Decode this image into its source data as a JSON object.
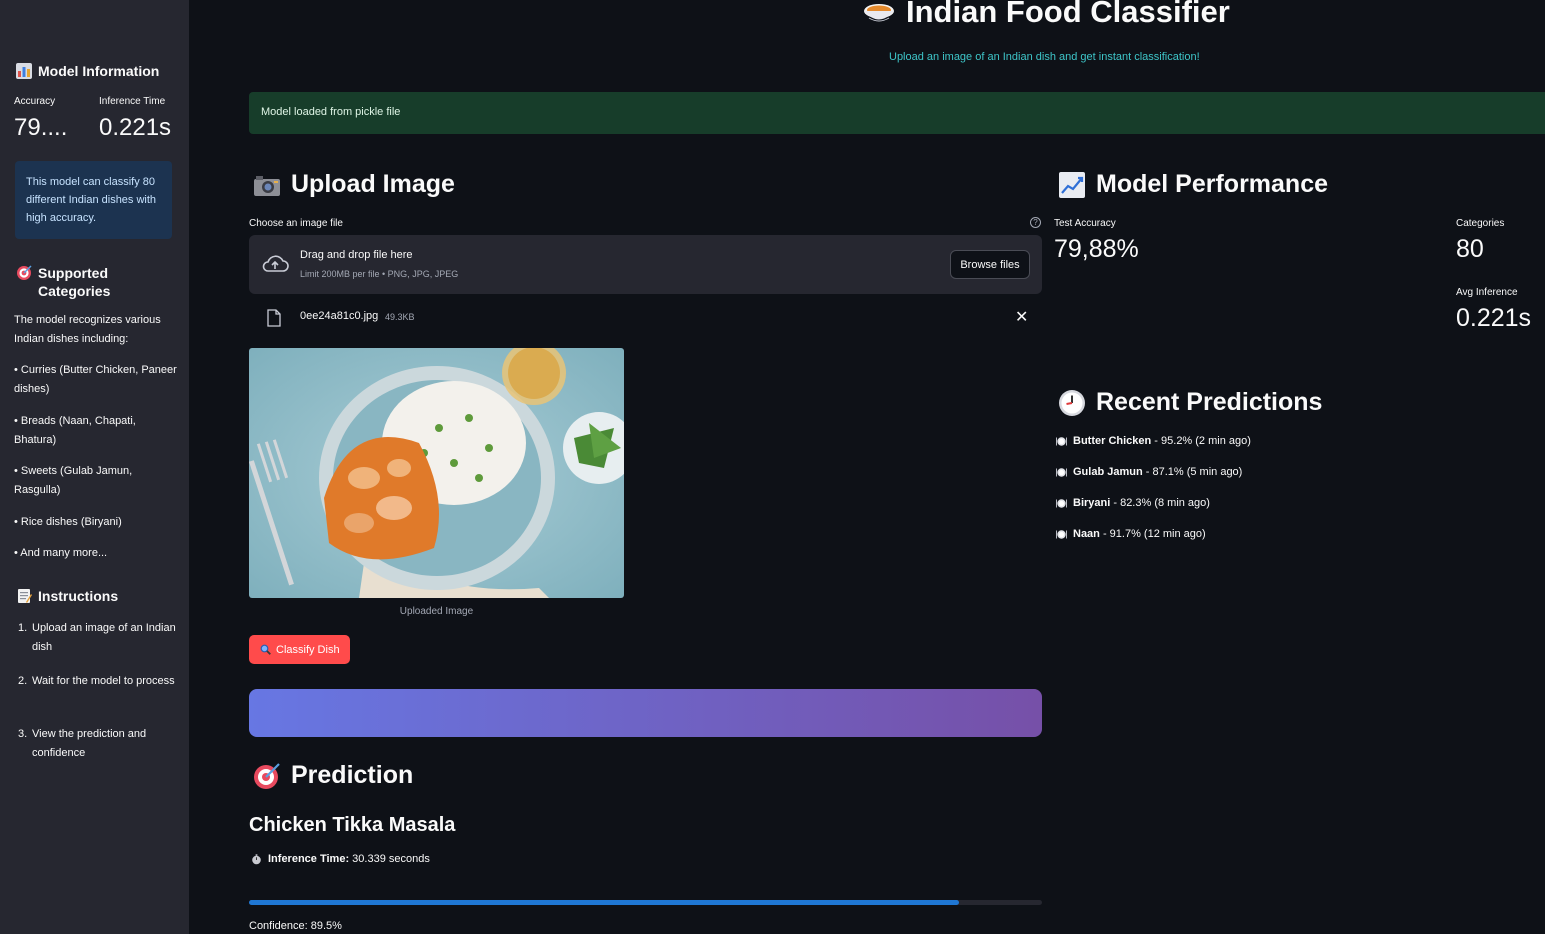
{
  "sidebar": {
    "model_info_heading": "Model Information",
    "accuracy_label": "Accuracy",
    "accuracy_value": "79....",
    "inference_label": "Inference Time",
    "inference_value": "0.221s",
    "info_text": "This model can classify 80 different Indian dishes with high accuracy.",
    "categories_heading": "Supported Categories",
    "categories_intro": "The model recognizes various Indian dishes including:",
    "categories": [
      "• Curries (Butter Chicken, Paneer dishes)",
      "• Breads (Naan, Chapati, Bhatura)",
      "• Sweets (Gulab Jamun, Rasgulla)",
      "• Rice dishes (Biryani)",
      "• And many more..."
    ],
    "instructions_heading": "Instructions",
    "instructions": [
      {
        "num": "1.",
        "text": "Upload an image of an Indian dish"
      },
      {
        "num": "2.",
        "text": "Wait for the model to process"
      },
      {
        "num": "3.",
        "text": "View the prediction and confidence"
      }
    ]
  },
  "header": {
    "title": "Indian Food Classifier",
    "subtitle": "Upload an image of an Indian dish and get instant classification!"
  },
  "status": {
    "success_message": "Model loaded from pickle file"
  },
  "upload": {
    "heading": "Upload Image",
    "field_label": "Choose an image file",
    "help_glyph": "?",
    "drag_text": "Drag and drop file here",
    "limit_text": "Limit 200MB per file • PNG, JPG, JPEG",
    "browse_label": "Browse files",
    "file_name": "0ee24a81c0.jpg",
    "file_size": "49.3KB",
    "close_glyph": "✕",
    "image_caption": "Uploaded Image",
    "classify_label": "Classify Dish"
  },
  "prediction": {
    "heading": "Prediction",
    "dish": "Chicken Tikka Masala",
    "inference_label": "Inference Time:",
    "inference_value": "30.339 seconds",
    "confidence_fraction": 0.895,
    "confidence_text": "Confidence: 89.5%"
  },
  "performance": {
    "heading": "Model Performance",
    "test_accuracy_label": "Test Accuracy",
    "test_accuracy_value": "79,88%",
    "categories_label": "Categories",
    "categories_value": "80",
    "avg_inference_label": "Avg Inference",
    "avg_inference_value": "0.221s"
  },
  "recent": {
    "heading": "Recent Predictions",
    "items": [
      {
        "dish": "Butter Chicken",
        "detail": " - 95.2% (2 min ago)"
      },
      {
        "dish": "Gulab Jamun",
        "detail": " - 87.1% (5 min ago)"
      },
      {
        "dish": "Biryani",
        "detail": " - 82.3% (8 min ago)"
      },
      {
        "dish": "Naan",
        "detail": " - 91.7% (12 min ago)"
      }
    ]
  },
  "colors": {
    "accent_red": "#ff4b4b",
    "progress_blue": "#1f77d4",
    "subtitle_teal": "#3ec6c9",
    "success_bg": "#173d2a",
    "info_bg": "#1c3350"
  },
  "icons": [
    "bar-chart-icon",
    "target-icon",
    "memo-icon",
    "curry-bowl-icon",
    "camera-icon",
    "chart-up-icon",
    "clock-icon",
    "cloud-upload-icon",
    "file-icon",
    "magnifier-icon",
    "plate-icon",
    "stopwatch-icon"
  ]
}
